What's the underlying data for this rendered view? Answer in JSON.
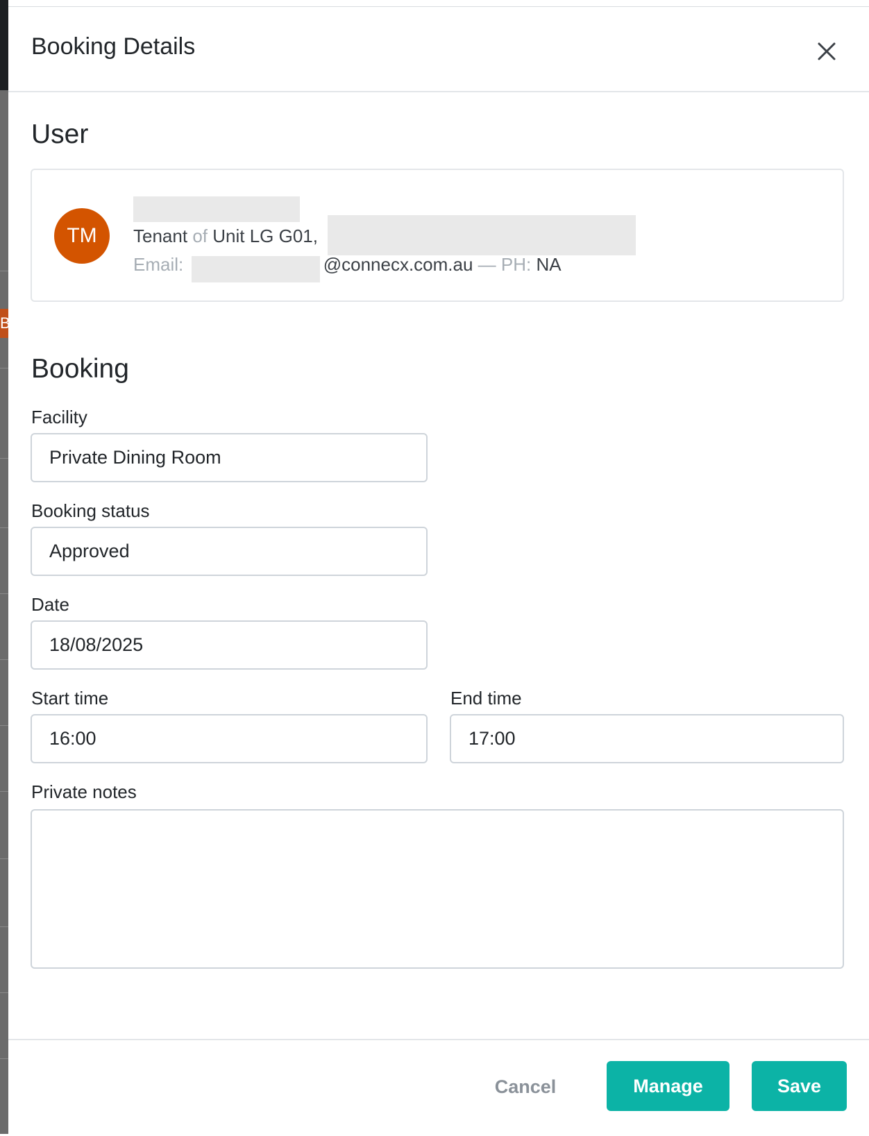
{
  "modal": {
    "title": "Booking Details"
  },
  "user_section": {
    "heading": "User",
    "avatar_initials": "TM",
    "tenant_word": "Tenant",
    "of_word": "of",
    "unit": "Unit LG G01,",
    "email_label": "Email:",
    "email_domain": "@connecx.com.au",
    "separator": "—",
    "phone_label": "PH:",
    "phone_value": "NA"
  },
  "booking_section": {
    "heading": "Booking",
    "facility": {
      "label": "Facility",
      "value": "Private Dining Room"
    },
    "status": {
      "label": "Booking status",
      "value": "Approved"
    },
    "date": {
      "label": "Date",
      "value": "18/08/2025"
    },
    "start_time": {
      "label": "Start time",
      "value": "16:00"
    },
    "end_time": {
      "label": "End time",
      "value": "17:00"
    },
    "notes": {
      "label": "Private notes",
      "value": ""
    }
  },
  "footer": {
    "cancel_label": "Cancel",
    "manage_label": "Manage",
    "save_label": "Save"
  },
  "colors": {
    "accent": "#0cb3a6",
    "avatar": "#d35400"
  },
  "icons": {
    "close": "close-icon"
  }
}
